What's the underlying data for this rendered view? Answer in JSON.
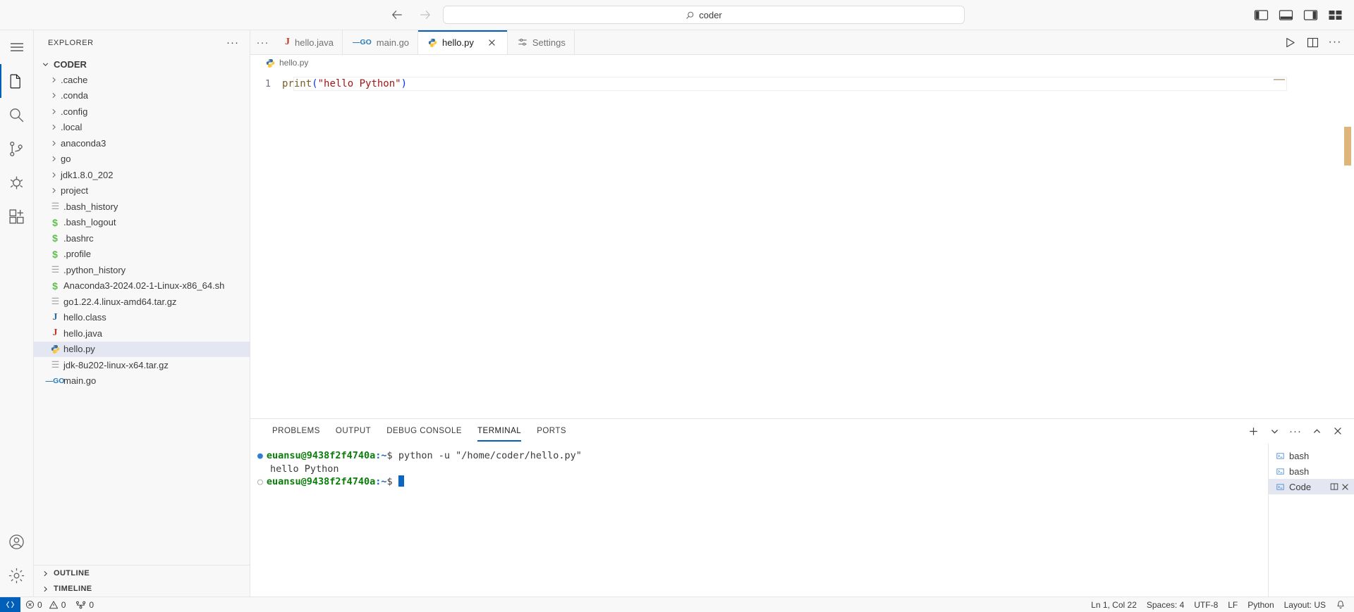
{
  "titlebar": {
    "back_icon": "arrow-left-icon",
    "forward_icon": "arrow-right-icon",
    "search_text": "coder",
    "search_icon": "search-icon",
    "layout_toggles": [
      "toggle-primary-sidebar",
      "toggle-panel",
      "toggle-secondary-sidebar",
      "customize-layout"
    ]
  },
  "activitybar": {
    "menu_icon": "hamburger-menu-icon",
    "items": [
      {
        "name": "explorer",
        "icon": "files-icon",
        "active": true
      },
      {
        "name": "search",
        "icon": "search-icon",
        "active": false
      },
      {
        "name": "source-control",
        "icon": "source-control-icon",
        "active": false
      },
      {
        "name": "run-and-debug",
        "icon": "debug-icon",
        "active": false
      },
      {
        "name": "extensions",
        "icon": "extensions-icon",
        "active": false
      }
    ],
    "bottom_items": [
      {
        "name": "accounts",
        "icon": "account-icon"
      },
      {
        "name": "settings",
        "icon": "gear-icon"
      }
    ]
  },
  "sidebar": {
    "title": "EXPLORER",
    "more_actions": "···",
    "root": {
      "label": "CODER",
      "expanded": true
    },
    "items": [
      {
        "label": ".cache",
        "type": "folder",
        "icon": "chevron-right-icon"
      },
      {
        "label": ".conda",
        "type": "folder",
        "icon": "chevron-right-icon"
      },
      {
        "label": ".config",
        "type": "folder",
        "icon": "chevron-right-icon"
      },
      {
        "label": ".local",
        "type": "folder",
        "icon": "chevron-right-icon"
      },
      {
        "label": "anaconda3",
        "type": "folder",
        "icon": "chevron-right-icon"
      },
      {
        "label": "go",
        "type": "folder",
        "icon": "chevron-right-icon"
      },
      {
        "label": "jdk1.8.0_202",
        "type": "folder",
        "icon": "chevron-right-icon"
      },
      {
        "label": "project",
        "type": "folder",
        "icon": "chevron-right-icon"
      },
      {
        "label": ".bash_history",
        "type": "text",
        "icon": "text-file-icon"
      },
      {
        "label": ".bash_logout",
        "type": "shell",
        "icon": "shell-file-icon"
      },
      {
        "label": ".bashrc",
        "type": "shell",
        "icon": "shell-file-icon"
      },
      {
        "label": ".profile",
        "type": "shell",
        "icon": "shell-file-icon"
      },
      {
        "label": ".python_history",
        "type": "text",
        "icon": "text-file-icon"
      },
      {
        "label": "Anaconda3-2024.02-1-Linux-x86_64.sh",
        "type": "shell",
        "icon": "shell-file-icon"
      },
      {
        "label": "go1.22.4.linux-amd64.tar.gz",
        "type": "text",
        "icon": "archive-file-icon"
      },
      {
        "label": "hello.class",
        "type": "class",
        "icon": "java-class-icon"
      },
      {
        "label": "hello.java",
        "type": "java",
        "icon": "java-file-icon"
      },
      {
        "label": "hello.py",
        "type": "python",
        "icon": "python-file-icon",
        "selected": true
      },
      {
        "label": "jdk-8u202-linux-x64.tar.gz",
        "type": "text",
        "icon": "archive-file-icon"
      },
      {
        "label": "main.go",
        "type": "go",
        "icon": "go-file-icon"
      }
    ],
    "footer": [
      {
        "label": "OUTLINE",
        "icon": "chevron-right-icon"
      },
      {
        "label": "TIMELINE",
        "icon": "chevron-right-icon"
      }
    ]
  },
  "editor": {
    "tab_overflow": "···",
    "tabs": [
      {
        "label": "hello.java",
        "icon": "java-file-icon",
        "active": false,
        "closable": false
      },
      {
        "label": "main.go",
        "icon": "go-file-icon",
        "active": false,
        "closable": false
      },
      {
        "label": "hello.py",
        "icon": "python-file-icon",
        "active": true,
        "closable": true,
        "close_icon": "close-icon"
      },
      {
        "label": "Settings",
        "icon": "settings-sliders-icon",
        "active": false,
        "closable": false
      }
    ],
    "actions": [
      {
        "name": "run-python-file",
        "icon": "play-icon"
      },
      {
        "name": "split-editor-right",
        "icon": "split-editor-icon"
      },
      {
        "name": "more-actions",
        "icon": "ellipsis-icon"
      }
    ],
    "breadcrumb": {
      "icon": "python-file-icon",
      "label": "hello.py"
    },
    "line_number": "1",
    "code": {
      "fn": "print",
      "open_paren": "(",
      "string": "\"hello Python\"",
      "close_paren": ")"
    }
  },
  "panel": {
    "tabs": [
      {
        "label": "PROBLEMS",
        "active": false
      },
      {
        "label": "OUTPUT",
        "active": false
      },
      {
        "label": "DEBUG CONSOLE",
        "active": false
      },
      {
        "label": "TERMINAL",
        "active": true
      },
      {
        "label": "PORTS",
        "active": false
      }
    ],
    "actions": [
      {
        "name": "new-terminal",
        "icon": "plus-icon"
      },
      {
        "name": "terminal-dropdown",
        "icon": "chevron-down-icon"
      },
      {
        "name": "terminal-views-and-more",
        "icon": "ellipsis-icon"
      },
      {
        "name": "maximize-panel",
        "icon": "chevron-up-icon"
      },
      {
        "name": "close-panel",
        "icon": "close-icon"
      }
    ],
    "terminal": {
      "prompt_user": "euansu@9438f2f4740a",
      "prompt_colon": ":",
      "prompt_path": "~",
      "prompt_dollar": "$",
      "command": " python -u \"/home/coder/hello.py\"",
      "output": "hello Python",
      "second_prompt_user": "euansu@9438f2f4740a",
      "second_prompt_colon": ":",
      "second_prompt_path": "~",
      "second_prompt_dollar": "$"
    },
    "terminal_list": [
      {
        "label": "bash",
        "icon": "terminal-bash-icon",
        "active": false
      },
      {
        "label": "bash",
        "icon": "terminal-bash-icon",
        "active": false
      },
      {
        "label": "Code",
        "icon": "terminal-bash-icon",
        "active": true,
        "split_icon": "split-icon",
        "close_icon": "close-icon"
      }
    ]
  },
  "statusbar": {
    "remote_label": "",
    "remote_icon": "remote-indicator-icon",
    "errors_icon": "error-icon",
    "errors": "0",
    "warnings_icon": "warning-icon",
    "warnings": "0",
    "ports_icon": "ports-icon",
    "ports": "0",
    "right_items": [
      {
        "name": "editor-position",
        "label": "Ln 1, Col 22"
      },
      {
        "name": "editor-indentation",
        "label": "Spaces: 4"
      },
      {
        "name": "editor-encoding",
        "label": "UTF-8"
      },
      {
        "name": "editor-eol",
        "label": "LF"
      },
      {
        "name": "editor-language",
        "label": "Python"
      },
      {
        "name": "layout-keyboard",
        "label": "Layout: US"
      }
    ],
    "bell_icon": "bell-icon"
  }
}
